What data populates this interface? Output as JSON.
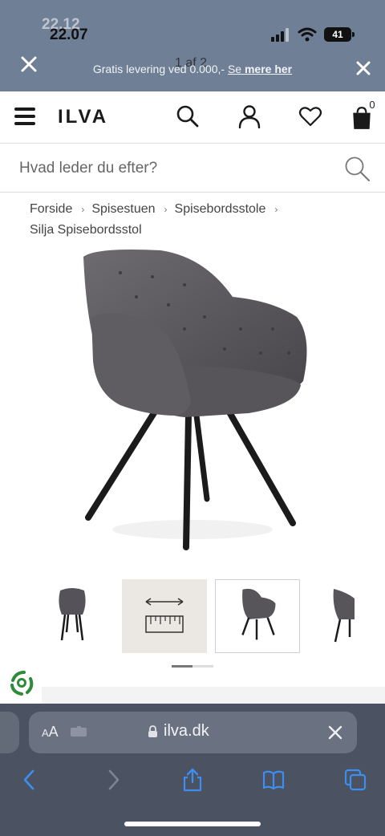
{
  "status": {
    "time_back": "22.12",
    "time_front": "22.07",
    "battery": "41"
  },
  "promo": {
    "text_before": "Gratis levering ved 0.000,- ",
    "link_prefix": "Se ",
    "link_bold": "mere her",
    "counter": "1 af 2"
  },
  "header": {
    "logo": "ILVA",
    "cart_count": "0"
  },
  "search": {
    "placeholder": "Hvad leder du efter?"
  },
  "breadcrumb": {
    "items": [
      "Forside",
      "Spisestuen",
      "Spisebordsstole"
    ],
    "current": "Silja Spisebordsstol",
    "separator": "›"
  },
  "product": {
    "chair_color": "#5b585d",
    "leg_color": "#1b1b1b"
  },
  "gallery": {
    "thumb_count": 4,
    "active_index": 2
  },
  "browser": {
    "aa_small": "A",
    "aa_big": "A",
    "url": "ilva.dk"
  },
  "icons": [
    "close-icon",
    "signal-icon",
    "wifi-icon",
    "battery-icon",
    "menu-icon",
    "search-icon",
    "account-icon",
    "heart-icon",
    "bag-icon",
    "lock-icon",
    "share-icon",
    "book-icon",
    "tabs-icon",
    "back-icon",
    "forward-icon",
    "measure-icon"
  ],
  "colors": {
    "promo_bar": "#6f7f96",
    "browser_bar": "#4b5261",
    "accent_link": "#1a73e8"
  }
}
